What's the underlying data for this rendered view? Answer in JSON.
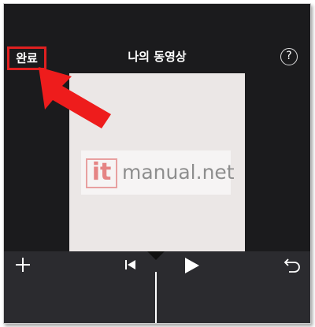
{
  "header": {
    "done_label": "완료",
    "title": "나의 동영상",
    "help_label": "?"
  },
  "watermark": {
    "brand_it": "it",
    "brand_rest": "manual.net"
  },
  "toolbar": {
    "icons": [
      "plus-icon",
      "skip-back-icon",
      "play-icon",
      "undo-icon"
    ]
  },
  "colors": {
    "highlight": "#e02020",
    "arrow": "#ee1c1c",
    "background": "#1b1b1d",
    "toolbar": "#2b2b2f"
  }
}
